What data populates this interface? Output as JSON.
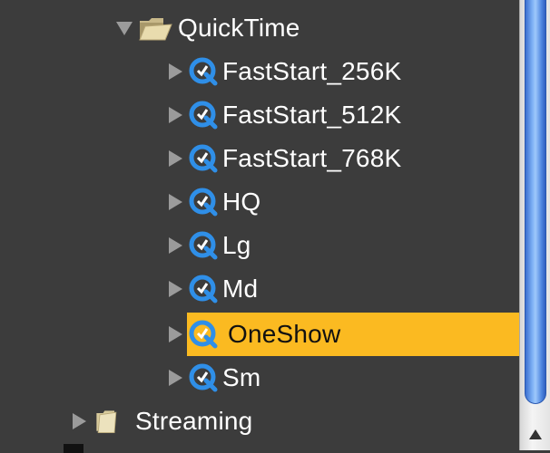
{
  "tree": {
    "parent": {
      "label": "QuickTime",
      "expanded": true,
      "icon": "open-folder-icon"
    },
    "children": [
      {
        "label": "FastStart_256K",
        "icon": "quicktime-icon",
        "selected": false
      },
      {
        "label": "FastStart_512K",
        "icon": "quicktime-icon",
        "selected": false
      },
      {
        "label": "FastStart_768K",
        "icon": "quicktime-icon",
        "selected": false
      },
      {
        "label": "HQ",
        "icon": "quicktime-icon",
        "selected": false
      },
      {
        "label": "Lg",
        "icon": "quicktime-icon",
        "selected": false
      },
      {
        "label": "Md",
        "icon": "quicktime-icon",
        "selected": false
      },
      {
        "label": "OneShow",
        "icon": "quicktime-icon",
        "selected": true
      },
      {
        "label": "Sm",
        "icon": "quicktime-icon",
        "selected": false
      }
    ],
    "sibling": {
      "label": "Streaming",
      "expanded": false,
      "icon": "folder-icon"
    }
  },
  "colors": {
    "background": "#3c3c3c",
    "selection": "#fbba21",
    "text": "#ffffff",
    "scroll_thumb": "#5a8fe6"
  }
}
